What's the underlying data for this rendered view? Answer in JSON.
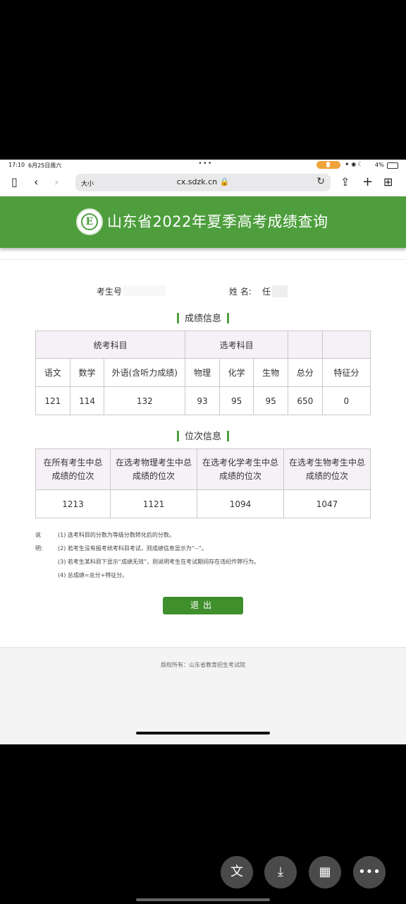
{
  "status_bar": {
    "time": "17:10",
    "date": "6月25日周六",
    "battery": "4%"
  },
  "browser": {
    "text_size_label": "大小",
    "url": "cx.sdzk.cn 🔒"
  },
  "site": {
    "title": "山东省2022年夏季高考成绩查询",
    "logo_letter": "E"
  },
  "student": {
    "exam_no_label": "考生号",
    "name_label": "姓 名:",
    "name_value": "任"
  },
  "score_section": {
    "title": "成绩信息",
    "group_unified": "统考科目",
    "group_elective": "选考科目",
    "columns": [
      "语文",
      "数学",
      "外语(含听力成绩)",
      "物理",
      "化学",
      "生物",
      "总分",
      "特征分"
    ],
    "values": [
      "121",
      "114",
      "132",
      "93",
      "95",
      "95",
      "650",
      "0"
    ]
  },
  "rank_section": {
    "title": "位次信息",
    "columns": [
      {
        "line1": "在所有考生中总",
        "line2": "成绩的位次"
      },
      {
        "line1": "在选考物理考生中总",
        "line2": "成绩的位次"
      },
      {
        "line1": "在选考化学考生中总",
        "line2": "成绩的位次"
      },
      {
        "line1": "在选考生物考生中总",
        "line2": "成绩的位次"
      }
    ],
    "values": [
      "1213",
      "1121",
      "1094",
      "1047"
    ]
  },
  "notes": {
    "label": "说明:",
    "items": [
      "(1) 选考科目的分数为等级分数转化后的分数。",
      "(2) 若考生没有报考统考科目考试，则成绩信息显示为“--”。",
      "(3) 若考生某科目下显示“成绩无效”，则说明考生在考试期间存在违纪作弊行为。",
      "(4) 总成绩=总分+特征分。"
    ]
  },
  "exit_button": "退出",
  "footer": {
    "copyright": "版权所有：山东省教育招生考试院"
  },
  "colors": {
    "brand_green": "#4e9e3d",
    "button_green": "#3f8f2c",
    "header_cell": "#f6f1f6"
  }
}
